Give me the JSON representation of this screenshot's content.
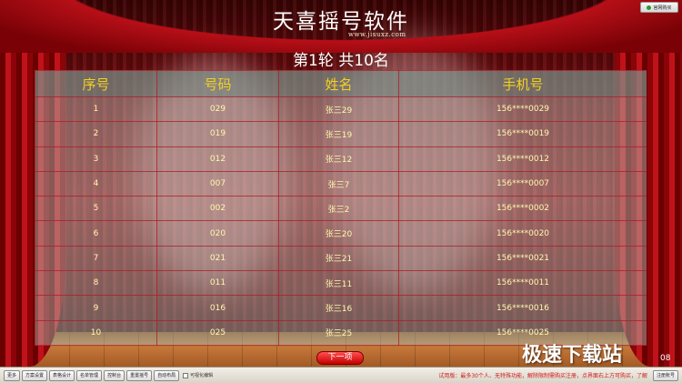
{
  "app": {
    "title": "天喜摇号软件",
    "url": "www.jisuxz.com",
    "top_button": "官网购买"
  },
  "round_label": "第1轮  共10名",
  "table": {
    "headers": [
      "序号",
      "号码",
      "姓名",
      "手机号"
    ],
    "rows": [
      [
        "1",
        "029",
        "张三29",
        "156****0029"
      ],
      [
        "2",
        "019",
        "张三19",
        "156****0019"
      ],
      [
        "3",
        "012",
        "张三12",
        "156****0012"
      ],
      [
        "4",
        "007",
        "张三7",
        "156****0007"
      ],
      [
        "5",
        "002",
        "张三2",
        "156****0002"
      ],
      [
        "6",
        "020",
        "张三20",
        "156****0020"
      ],
      [
        "7",
        "021",
        "张三21",
        "156****0021"
      ],
      [
        "8",
        "011",
        "张三11",
        "156****0011"
      ],
      [
        "9",
        "016",
        "张三16",
        "156****0016"
      ],
      [
        "10",
        "025",
        "张三25",
        "156****0025"
      ]
    ]
  },
  "next_button": "下一项",
  "watermark": {
    "brand": "极速下载站",
    "suffix": "08"
  },
  "toolbar": {
    "buttons": [
      "更多",
      "方案设置",
      "表格设计",
      "名单管理",
      "控制台",
      "重置摇号",
      "自动布局"
    ],
    "checkbox_label": "可视化编辑",
    "trial_notice": "试用版：最多30个人、无特殊功能，解除限制需购买注册，点界面右上方可购买，了解",
    "register_button": "注册账号"
  },
  "colors": {
    "header_text": "#f4d020",
    "cell_text": "#fff8b0",
    "trial_text": "#d01818",
    "grid_lines": "#aa1e28"
  }
}
